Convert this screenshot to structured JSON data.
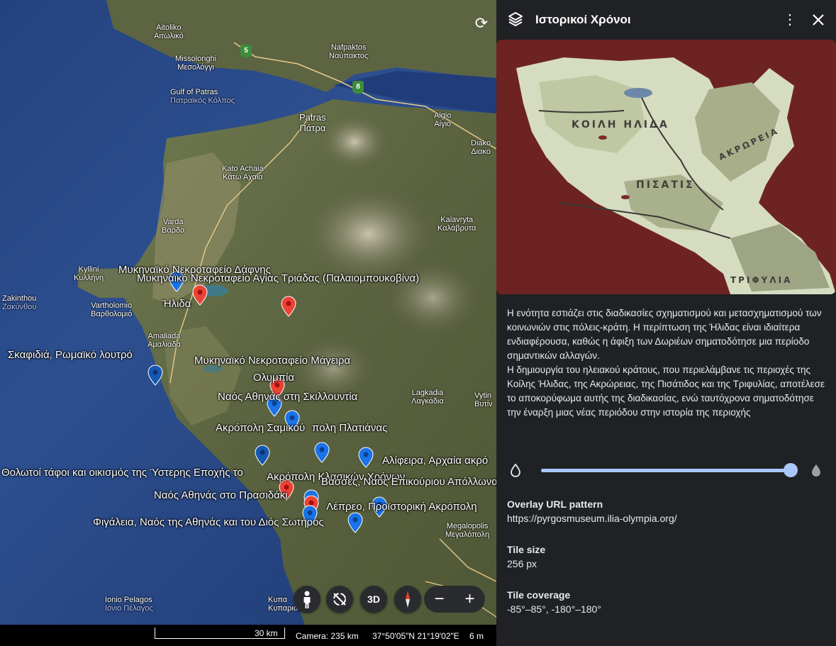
{
  "map": {
    "rotate_icon": "rotate-icon",
    "labels": [
      {
        "id": "aitoliko",
        "primary": "Aitoliko",
        "secondary": "Αιτωλικό"
      },
      {
        "id": "missolonghi",
        "primary": "Missolonghi",
        "secondary": "Μεσολόγγι"
      },
      {
        "id": "nafpaktos",
        "primary": "Nafpaktos",
        "secondary": "Ναύπακτος"
      },
      {
        "id": "gulf",
        "primary": "Gulf of Patras",
        "secondary": "Πατραϊκός Κόλπος"
      },
      {
        "id": "patras",
        "primary": "Patras",
        "secondary": "Πάτρα"
      },
      {
        "id": "aigio",
        "primary": "Aigio",
        "secondary": "Αίγιο"
      },
      {
        "id": "diako",
        "primary": "Diako",
        "secondary": "Διακο"
      },
      {
        "id": "kato",
        "primary": "Kato Achaia",
        "secondary": "Κάτω Αχαΐα"
      },
      {
        "id": "varda",
        "primary": "Varda",
        "secondary": "Βάρδα"
      },
      {
        "id": "kalavryta",
        "primary": "Kalavryta",
        "secondary": "Καλάβρυτα"
      },
      {
        "id": "kyllini",
        "primary": "Kyllini",
        "secondary": "Κυλλήνη"
      },
      {
        "id": "zakinthou",
        "primary": "Zakinthou",
        "secondary": "Ζακύνθου"
      },
      {
        "id": "vartholomio",
        "primary": "Vartholomio",
        "secondary": "Βαρθολομιό"
      },
      {
        "id": "amaliada",
        "primary": "Amaliada",
        "secondary": "Αμαλιάδα"
      },
      {
        "id": "lagkadia",
        "primary": "Lagkadia",
        "secondary": "Λαγκάδια"
      },
      {
        "id": "vytina",
        "primary": "Vytin",
        "secondary": "Βυτίν"
      },
      {
        "id": "megalopolis",
        "primary": "Megalopolis",
        "secondary": "Μεγαλόπολη"
      },
      {
        "id": "ionio",
        "primary": "Ionio Pelagos",
        "secondary": "Ιόνιο Πέλαγος"
      },
      {
        "id": "kyparissia",
        "primary": "Κυπα",
        "secondary": "Κυπαρισσ"
      }
    ],
    "road_shields": [
      "5",
      "8"
    ],
    "place_labels": [
      {
        "id": "dafni",
        "text": "Μυκηναϊκό Νεκροταφείο Δάφνης"
      },
      {
        "id": "agia-triada",
        "text": "Μυκηναϊκό Νεκροταφείο Αγίας Τριάδας (Παλαιομπουκοβίνα)"
      },
      {
        "id": "ilida",
        "text": "Ήλιδα"
      },
      {
        "id": "skafidia",
        "text": "Σκαφιδιά, Ρωμαϊκό λουτρό"
      },
      {
        "id": "mageira",
        "text": "Μυκηναϊκό Νεκροταφείο Μάγειρα"
      },
      {
        "id": "olympia",
        "text": "Ολυμπία"
      },
      {
        "id": "skillountia",
        "text": "Ναός Αθηνάς στη Σκιλλουντία"
      },
      {
        "id": "samikon",
        "text": "Ακρόπολη Σαμικού"
      },
      {
        "id": "platiana",
        "text": "πολη Πλατιάνας"
      },
      {
        "id": "alifeira",
        "text": "Αλίφειρα, Αρχαία ακρό"
      },
      {
        "id": "tholotoi",
        "text": "Θολωτοί τάφοι και οικισμός  της Ύστερης Εποχής το"
      },
      {
        "id": "akropoli-klassikon",
        "text": "Ακρόπολη Κλασικών Χρόνων"
      },
      {
        "id": "epikouriou",
        "text": "Βάσσες, Ναός Επικούριου Απόλλωνα"
      },
      {
        "id": "prasidaki",
        "text": "Ναός Αθηνάς στο Πρασιδάκι"
      },
      {
        "id": "lepreo",
        "text": "Λέπρεο, Προϊστορική Ακρόπολη"
      },
      {
        "id": "figaleia",
        "text": "Φιγάλεια, Ναός της Αθηνάς και του Διός Σωτήρος"
      }
    ],
    "controls": {
      "pegman_icon": "pegman-icon",
      "tilt_icon": "tilt-reset-icon",
      "view_3d": "3D",
      "compass_icon": "compass-icon",
      "zoom_out": "−",
      "zoom_in": "+"
    },
    "colors": {
      "pin_blue": "#1a73e8",
      "pin_dark_blue": "#1558b0",
      "pin_red": "#ea4335",
      "shield_green": "#3c8c3a"
    }
  },
  "statusbar": {
    "scale": "30 km",
    "camera": "Camera: 235 km",
    "coords": "37°50'05\"N 21°19'02\"E",
    "elevation": "6 m"
  },
  "panel": {
    "layers_icon": "layers-icon",
    "title": "Ιστορικοί Χρόνοι",
    "more_icon": "more-vert-icon",
    "close_icon": "close-icon",
    "overlay_labels": {
      "koili": "ΚΟΙΛΗ ΗΛΙΔΑ",
      "akroreia": "ΑΚΡΩΡΕΙΑ",
      "pisatis": "ΠΙΣΑΤΙΣ",
      "trifylia": "ΤΡΙΦΥΛΙΑ"
    },
    "description": "Η ενότητα εστιάζει στις διαδικασίες σχηματισμού και μετασχηματισμού των κοινωνιών στις πόλεις-κράτη. Η περίπτωση της Ήλιδας είναι ιδιαίτερα ενδιαφέρουσα, καθώς η άφιξη των Δωριέων σηματοδότησε μια περίοδο σημαντικών αλλαγών.\nΗ δημιουργία του ηλειακού κράτους, που περιελάμβανε τις περιοχές της Κοίλης Ήλιδας, της Ακρώρειας, της Πισάτιδος και της Τριφυλίας, αποτέλεσε το αποκορύφωμα αυτής της διαδικασίας, ενώ ταυτόχρονα σηματοδότησε την έναρξη μιας νέας περιόδου στην ιστορία της περιοχής",
    "opacity": {
      "value": 1.0,
      "min_icon": "opacity-low-icon",
      "max_icon": "opacity-high-icon",
      "accent": "#a8c7fa"
    },
    "props": {
      "url_label": "Overlay URL pattern",
      "url_value": "https://pyrgosmuseum.ilia-olympia.org/",
      "tile_size_label": "Tile size",
      "tile_size_value": "256 px",
      "coverage_label": "Tile coverage",
      "coverage_value": "-85°–85°, -180°–180°"
    }
  }
}
